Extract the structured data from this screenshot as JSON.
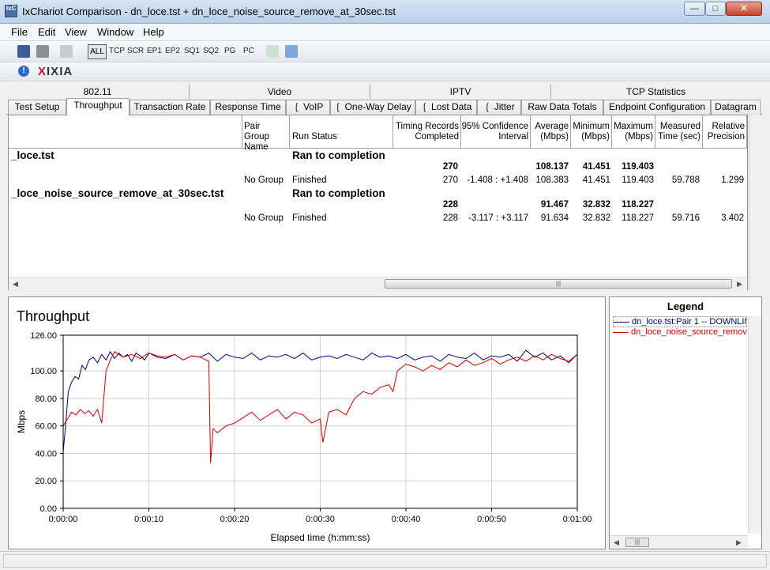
{
  "window": {
    "title": "IxChariot Comparison - dn_loce.tst + dn_loce_noise_source_remove_at_30sec.tst",
    "icon_label": "IxC"
  },
  "menu": [
    "File",
    "Edit",
    "View",
    "Window",
    "Help"
  ],
  "toolbar": {
    "filters": [
      "ALL",
      "TCP",
      "SCR",
      "EP1",
      "EP2",
      "SQ1",
      "SQ2",
      "PG",
      "PC"
    ]
  },
  "brand": {
    "logo_x": "X",
    "logo_text": "IXIA"
  },
  "tabs_row1": [
    "802.11",
    "Video",
    "IPTV",
    "TCP Statistics"
  ],
  "tabs_row2": [
    "Test Setup",
    "Throughput",
    "Transaction Rate",
    "Response Time",
    "VoIP",
    "One-Way Delay",
    "Lost Data",
    "Jitter",
    "Raw Data Totals",
    "Endpoint Configuration",
    "Datagram"
  ],
  "table": {
    "headers": [
      "Pair Group Name",
      "Run Status",
      "Timing Records Completed",
      "95% Confidence Interval",
      "Average (Mbps)",
      "Minimum (Mbps)",
      "Maximum (Mbps)",
      "Measured Time (sec)",
      "Relative Precision"
    ],
    "tests": [
      {
        "name": "_loce.tst",
        "status": "Ran to completion",
        "summary": {
          "records": "270",
          "average": "108.137",
          "minimum": "41.451",
          "maximum": "119.403"
        },
        "pair": {
          "group": "No Group",
          "status": "Finished",
          "records": "270",
          "ci": "-1.408 : +1.408",
          "average": "108.383",
          "minimum": "41.451",
          "maximum": "119.403",
          "time": "59.788",
          "precision": "1.299"
        }
      },
      {
        "name": "_loce_noise_source_remove_at_30sec.tst",
        "status": "Ran to completion",
        "summary": {
          "records": "228",
          "average": "91.467",
          "minimum": "32.832",
          "maximum": "118.227"
        },
        "pair": {
          "group": "No Group",
          "status": "Finished",
          "records": "228",
          "ci": "-3.117 : +3.117",
          "average": "91.634",
          "minimum": "32.832",
          "maximum": "118.227",
          "time": "59.716",
          "precision": "3.402"
        }
      }
    ]
  },
  "legend": {
    "title": "Legend",
    "items": [
      {
        "label": "dn_loce.tst:Pair 1 -- DOWNLIN",
        "color": "#000080"
      },
      {
        "label": "dn_loce_noise_source_remov",
        "color": "#cc0000"
      }
    ]
  },
  "chart_data": {
    "type": "line",
    "title": "Throughput",
    "xlabel": "Elapsed time (h:mm:ss)",
    "ylabel": "Mbps",
    "ylim": [
      0,
      126
    ],
    "xlim": [
      0,
      60
    ],
    "yticks": [
      "0.00",
      "20.00",
      "40.00",
      "60.00",
      "80.00",
      "100.00",
      "126.00"
    ],
    "ytick_values": [
      0,
      20,
      40,
      60,
      80,
      100,
      126
    ],
    "xticks": [
      "0:00:00",
      "0:00:10",
      "0:00:20",
      "0:00:30",
      "0:00:40",
      "0:00:50",
      "0:01:00"
    ],
    "grid": true,
    "series": [
      {
        "name": "dn_loce.tst:Pair 1 -- DOWNLIN",
        "color": "#000080",
        "x": [
          0,
          0.3,
          0.6,
          1,
          1.4,
          1.8,
          2.2,
          2.6,
          3,
          3.5,
          4,
          4.5,
          5,
          5.5,
          6,
          6.5,
          7,
          7.5,
          8,
          8.5,
          9,
          9.5,
          10,
          11,
          12,
          13,
          14,
          15,
          16,
          17,
          18,
          19,
          20,
          21,
          22,
          23,
          24,
          25,
          26,
          27,
          28,
          29,
          30,
          31,
          32,
          33,
          34,
          35,
          36,
          37,
          38,
          39,
          40,
          41,
          42,
          43,
          44,
          45,
          46,
          47,
          48,
          49,
          50,
          51,
          52,
          53,
          54,
          55,
          56,
          57,
          58,
          59,
          60
        ],
        "y": [
          41,
          62,
          85,
          92,
          96,
          94,
          104,
          101,
          108,
          110,
          106,
          112,
          108,
          114,
          109,
          113,
          110,
          112,
          107,
          113,
          111,
          108,
          113,
          110,
          109,
          112,
          108,
          111,
          110,
          113,
          107,
          112,
          110,
          109,
          113,
          108,
          111,
          110,
          112,
          109,
          113,
          108,
          110,
          111,
          109,
          112,
          110,
          108,
          113,
          110,
          111,
          109,
          112,
          108,
          110,
          111,
          107,
          112,
          110,
          109,
          113,
          108,
          111,
          110,
          112,
          107,
          115,
          110,
          113,
          108,
          111,
          106,
          112
        ]
      },
      {
        "name": "dn_loce_noise_source_remov",
        "color": "#cc0000",
        "x": [
          0,
          0.5,
          1,
          1.5,
          2,
          2.5,
          3,
          3.5,
          4,
          4.5,
          5,
          5.5,
          6,
          7,
          8,
          9,
          10,
          11,
          12,
          13,
          14,
          15,
          16,
          17,
          17.2,
          17.5,
          18,
          19,
          20,
          21,
          22,
          23,
          24,
          25,
          26,
          27,
          28,
          29,
          30,
          30.3,
          31,
          32,
          33,
          34,
          35,
          36,
          37,
          38,
          38.5,
          39,
          40,
          41,
          42,
          43,
          44,
          45,
          46,
          47,
          48,
          49,
          50,
          51,
          52,
          53,
          54,
          55,
          56,
          57,
          58,
          59,
          60
        ],
        "y": [
          60,
          65,
          70,
          68,
          72,
          69,
          71,
          67,
          72,
          62,
          100,
          108,
          114,
          110,
          112,
          109,
          113,
          111,
          110,
          112,
          108,
          111,
          110,
          107,
          33,
          58,
          55,
          60,
          62,
          66,
          70,
          64,
          68,
          72,
          65,
          70,
          68,
          62,
          65,
          48,
          70,
          72,
          68,
          80,
          85,
          83,
          88,
          90,
          85,
          100,
          105,
          103,
          100,
          104,
          101,
          106,
          103,
          108,
          104,
          106,
          109,
          105,
          108,
          110,
          107,
          111,
          108,
          112,
          109,
          107,
          112
        ]
      }
    ]
  }
}
